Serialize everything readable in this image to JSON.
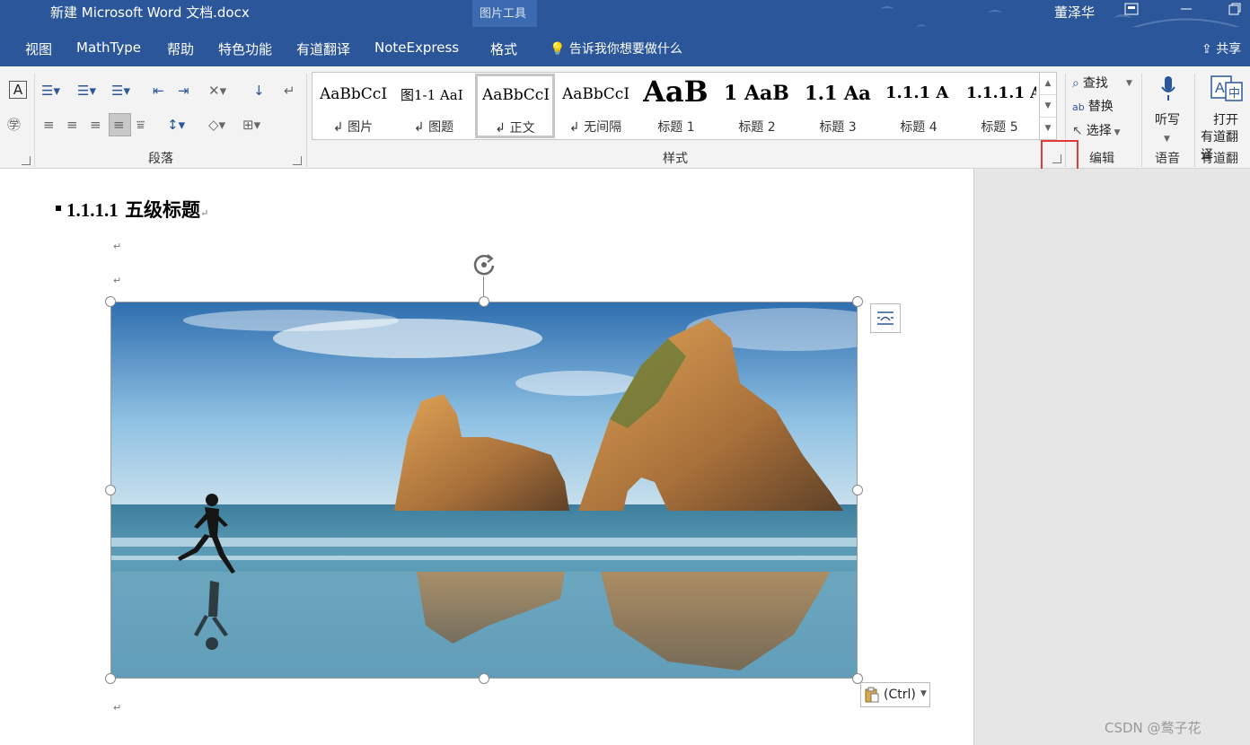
{
  "window": {
    "title": "新建 Microsoft Word 文档.docx",
    "context_tab_group": "图片工具",
    "user": "董泽华"
  },
  "tabs": [
    {
      "label": "视图"
    },
    {
      "label": "MathType"
    },
    {
      "label": "帮助"
    },
    {
      "label": "特色功能"
    },
    {
      "label": "有道翻译"
    },
    {
      "label": "NoteExpress"
    },
    {
      "label": "格式"
    }
  ],
  "tell_me": "告诉我你想要做什么",
  "share": "共享",
  "ribbon": {
    "paragraph_group": "段落",
    "styles_group": "样式",
    "edit_group": "编辑",
    "voice_group": "语音",
    "youdao_group": "有道翻译",
    "styles": [
      {
        "sample": "AaBbCcI",
        "name": "↲ 图片"
      },
      {
        "sample": "图1-1  AaI",
        "name": "↲ 图题"
      },
      {
        "sample": "AaBbCcI",
        "name": "↲ 正文"
      },
      {
        "sample": "AaBbCcI",
        "name": "↲ 无间隔"
      },
      {
        "sample": "AaB",
        "name": "标题 1"
      },
      {
        "sample": "1  AaB",
        "name": "标题 2"
      },
      {
        "sample": "1.1  Aa",
        "name": "标题 3"
      },
      {
        "sample": "1.1.1  A",
        "name": "标题 4"
      },
      {
        "sample": "1.1.1.1  A",
        "name": "标题 5"
      }
    ],
    "edit": {
      "find": "查找",
      "replace": "替换",
      "select": "选择"
    },
    "dictate": "听写",
    "open_youdao_line1": "打开",
    "open_youdao_line2": "有道翻译"
  },
  "document": {
    "heading_number": "1.1.1.1",
    "heading_text": "五级标题",
    "paragraph_mark": "↵",
    "paste_options": "(Ctrl)"
  },
  "watermark": "CSDN @鹜子花",
  "colors": {
    "title_bar": "#2b579a",
    "highlight_box": "#e23a3a"
  }
}
